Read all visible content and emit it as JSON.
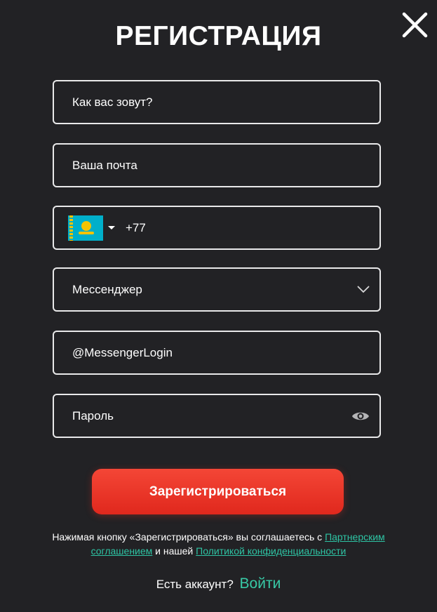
{
  "header": {
    "title": "РЕГИСТРАЦИЯ",
    "close_icon": "close-icon"
  },
  "form": {
    "name_placeholder": "Как вас зовут?",
    "email_placeholder": "Ваша почта",
    "phone": {
      "country_flag": "kazakhstan-flag-icon",
      "caret_icon": "caret-down-icon",
      "code_value": "+77"
    },
    "messenger": {
      "selected_label": "Мессенджер",
      "chevron_icon": "chevron-down-icon"
    },
    "messenger_login_placeholder": "@MessengerLogin",
    "password": {
      "placeholder": "Пароль",
      "toggle_icon": "eye-icon"
    }
  },
  "submit_label": "Зарегистрироваться",
  "terms": {
    "text_before": "Нажимая кнопку «Зарегистрироваться» вы соглашаетесь с ",
    "partner_link": "Партнерским соглашением",
    "text_middle": " и нашей ",
    "privacy_link": "Политикой конфиденциальности"
  },
  "login": {
    "question": "Есть аккаунт?",
    "link": "Войти"
  },
  "colors": {
    "background": "#222225",
    "accent_red": "#e53323",
    "link_green": "#2ec4a4",
    "border": "#e9e9ea"
  }
}
